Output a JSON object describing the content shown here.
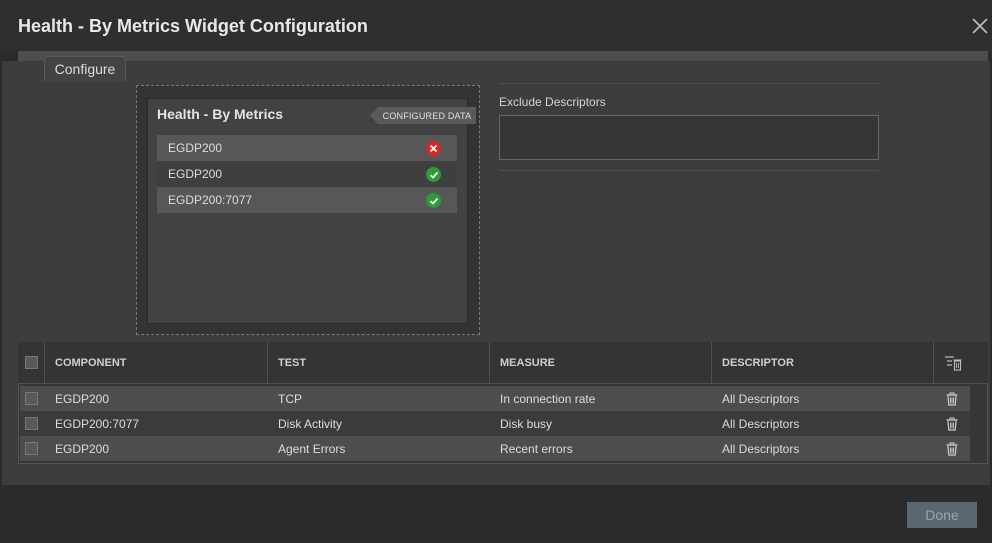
{
  "dialog": {
    "title": "Health - By Metrics Widget Configuration"
  },
  "tabs": [
    {
      "label": "Configure"
    }
  ],
  "preview": {
    "widget_title": "Health - By Metrics",
    "badge": "CONFIGURED DATA",
    "rows": [
      {
        "label": "EGDP200",
        "status": "error"
      },
      {
        "label": "EGDP200",
        "status": "ok"
      },
      {
        "label": "EGDP200:7077",
        "status": "ok"
      }
    ]
  },
  "exclude": {
    "label": "Exclude Descriptors",
    "value": ""
  },
  "table": {
    "headers": {
      "component": "COMPONENT",
      "test": "TEST",
      "measure": "MEASURE",
      "descriptor": "DESCRIPTOR"
    },
    "rows": [
      {
        "component": "EGDP200",
        "test": "TCP",
        "measure": "In connection rate",
        "descriptor": "All Descriptors"
      },
      {
        "component": "EGDP200:7077",
        "test": "Disk Activity",
        "measure": "Disk busy",
        "descriptor": "All Descriptors"
      },
      {
        "component": "EGDP200",
        "test": "Agent Errors",
        "measure": "Recent errors",
        "descriptor": "All Descriptors"
      }
    ]
  },
  "footer": {
    "done_label": "Done"
  },
  "colors": {
    "error": "#d9262a",
    "ok": "#2e9a3a"
  }
}
